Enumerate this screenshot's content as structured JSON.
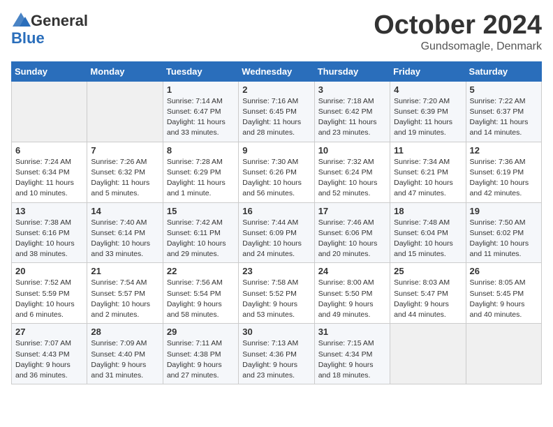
{
  "logo": {
    "general": "General",
    "blue": "Blue"
  },
  "title": {
    "month": "October 2024",
    "location": "Gundsomagle, Denmark"
  },
  "headers": [
    "Sunday",
    "Monday",
    "Tuesday",
    "Wednesday",
    "Thursday",
    "Friday",
    "Saturday"
  ],
  "weeks": [
    [
      {
        "day": "",
        "info": ""
      },
      {
        "day": "",
        "info": ""
      },
      {
        "day": "1",
        "info": "Sunrise: 7:14 AM\nSunset: 6:47 PM\nDaylight: 11 hours\nand 33 minutes."
      },
      {
        "day": "2",
        "info": "Sunrise: 7:16 AM\nSunset: 6:45 PM\nDaylight: 11 hours\nand 28 minutes."
      },
      {
        "day": "3",
        "info": "Sunrise: 7:18 AM\nSunset: 6:42 PM\nDaylight: 11 hours\nand 23 minutes."
      },
      {
        "day": "4",
        "info": "Sunrise: 7:20 AM\nSunset: 6:39 PM\nDaylight: 11 hours\nand 19 minutes."
      },
      {
        "day": "5",
        "info": "Sunrise: 7:22 AM\nSunset: 6:37 PM\nDaylight: 11 hours\nand 14 minutes."
      }
    ],
    [
      {
        "day": "6",
        "info": "Sunrise: 7:24 AM\nSunset: 6:34 PM\nDaylight: 11 hours\nand 10 minutes."
      },
      {
        "day": "7",
        "info": "Sunrise: 7:26 AM\nSunset: 6:32 PM\nDaylight: 11 hours\nand 5 minutes."
      },
      {
        "day": "8",
        "info": "Sunrise: 7:28 AM\nSunset: 6:29 PM\nDaylight: 11 hours\nand 1 minute."
      },
      {
        "day": "9",
        "info": "Sunrise: 7:30 AM\nSunset: 6:26 PM\nDaylight: 10 hours\nand 56 minutes."
      },
      {
        "day": "10",
        "info": "Sunrise: 7:32 AM\nSunset: 6:24 PM\nDaylight: 10 hours\nand 52 minutes."
      },
      {
        "day": "11",
        "info": "Sunrise: 7:34 AM\nSunset: 6:21 PM\nDaylight: 10 hours\nand 47 minutes."
      },
      {
        "day": "12",
        "info": "Sunrise: 7:36 AM\nSunset: 6:19 PM\nDaylight: 10 hours\nand 42 minutes."
      }
    ],
    [
      {
        "day": "13",
        "info": "Sunrise: 7:38 AM\nSunset: 6:16 PM\nDaylight: 10 hours\nand 38 minutes."
      },
      {
        "day": "14",
        "info": "Sunrise: 7:40 AM\nSunset: 6:14 PM\nDaylight: 10 hours\nand 33 minutes."
      },
      {
        "day": "15",
        "info": "Sunrise: 7:42 AM\nSunset: 6:11 PM\nDaylight: 10 hours\nand 29 minutes."
      },
      {
        "day": "16",
        "info": "Sunrise: 7:44 AM\nSunset: 6:09 PM\nDaylight: 10 hours\nand 24 minutes."
      },
      {
        "day": "17",
        "info": "Sunrise: 7:46 AM\nSunset: 6:06 PM\nDaylight: 10 hours\nand 20 minutes."
      },
      {
        "day": "18",
        "info": "Sunrise: 7:48 AM\nSunset: 6:04 PM\nDaylight: 10 hours\nand 15 minutes."
      },
      {
        "day": "19",
        "info": "Sunrise: 7:50 AM\nSunset: 6:02 PM\nDaylight: 10 hours\nand 11 minutes."
      }
    ],
    [
      {
        "day": "20",
        "info": "Sunrise: 7:52 AM\nSunset: 5:59 PM\nDaylight: 10 hours\nand 6 minutes."
      },
      {
        "day": "21",
        "info": "Sunrise: 7:54 AM\nSunset: 5:57 PM\nDaylight: 10 hours\nand 2 minutes."
      },
      {
        "day": "22",
        "info": "Sunrise: 7:56 AM\nSunset: 5:54 PM\nDaylight: 9 hours\nand 58 minutes."
      },
      {
        "day": "23",
        "info": "Sunrise: 7:58 AM\nSunset: 5:52 PM\nDaylight: 9 hours\nand 53 minutes."
      },
      {
        "day": "24",
        "info": "Sunrise: 8:00 AM\nSunset: 5:50 PM\nDaylight: 9 hours\nand 49 minutes."
      },
      {
        "day": "25",
        "info": "Sunrise: 8:03 AM\nSunset: 5:47 PM\nDaylight: 9 hours\nand 44 minutes."
      },
      {
        "day": "26",
        "info": "Sunrise: 8:05 AM\nSunset: 5:45 PM\nDaylight: 9 hours\nand 40 minutes."
      }
    ],
    [
      {
        "day": "27",
        "info": "Sunrise: 7:07 AM\nSunset: 4:43 PM\nDaylight: 9 hours\nand 36 minutes."
      },
      {
        "day": "28",
        "info": "Sunrise: 7:09 AM\nSunset: 4:40 PM\nDaylight: 9 hours\nand 31 minutes."
      },
      {
        "day": "29",
        "info": "Sunrise: 7:11 AM\nSunset: 4:38 PM\nDaylight: 9 hours\nand 27 minutes."
      },
      {
        "day": "30",
        "info": "Sunrise: 7:13 AM\nSunset: 4:36 PM\nDaylight: 9 hours\nand 23 minutes."
      },
      {
        "day": "31",
        "info": "Sunrise: 7:15 AM\nSunset: 4:34 PM\nDaylight: 9 hours\nand 18 minutes."
      },
      {
        "day": "",
        "info": ""
      },
      {
        "day": "",
        "info": ""
      }
    ]
  ]
}
